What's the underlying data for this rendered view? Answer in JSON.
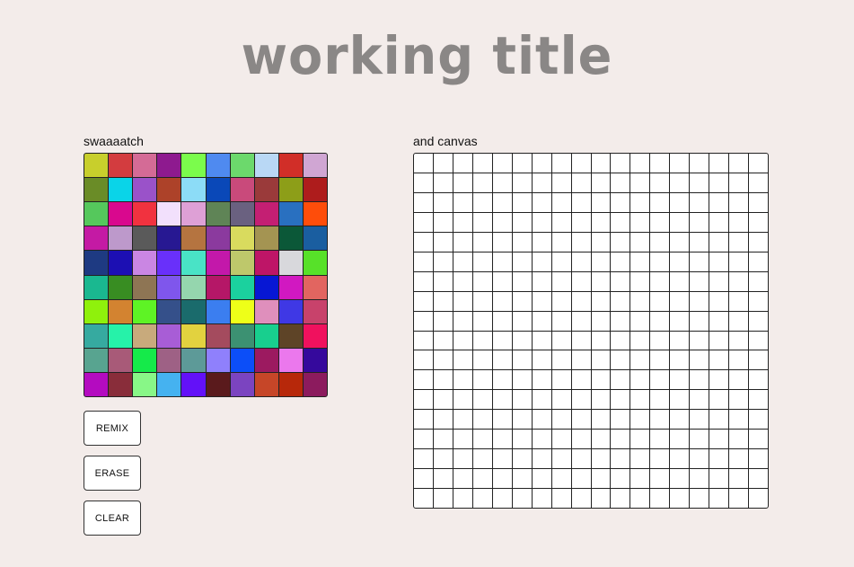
{
  "title": "working title",
  "swatch_section": {
    "label": "swaaaatch",
    "colors": [
      "#c8cf2c",
      "#d33c3f",
      "#d46b96",
      "#8e1a8f",
      "#7bfc4c",
      "#4f8af0",
      "#6cd96c",
      "#b9d8f5",
      "#d12e28",
      "#d0a6d3",
      "#6a8c27",
      "#0ad4e8",
      "#9a52c9",
      "#ad4229",
      "#8cdcf7",
      "#0a48b8",
      "#c94a7b",
      "#9a3a3a",
      "#8d9e18",
      "#ae1c1c",
      "#55c85c",
      "#d9088e",
      "#f1323f",
      "#f2e0fc",
      "#dea0d6",
      "#5f8456",
      "#6a6180",
      "#c41f73",
      "#2970c0",
      "#fe4d0a",
      "#c41aa4",
      "#bd99cb",
      "#5a5a5a",
      "#271892",
      "#b57440",
      "#8b3a9e",
      "#d9db5e",
      "#a49452",
      "#0b5838",
      "#1a5ea0",
      "#1e3a82",
      "#1c0fb3",
      "#ca86e3",
      "#6930fa",
      "#49e3c6",
      "#c318aa",
      "#bec86b",
      "#be1567",
      "#d8d8dc",
      "#57e129",
      "#1ab890",
      "#388d22",
      "#8e7554",
      "#7f56ec",
      "#95d6ae",
      "#b51767",
      "#1bd19e",
      "#0717d4",
      "#d118c1",
      "#e26560",
      "#8ff10c",
      "#d38330",
      "#5ef325",
      "#35508a",
      "#1a6b6c",
      "#3b7ef0",
      "#eeff18",
      "#df8fbc",
      "#3f38e5",
      "#c8426b",
      "#36aaa0",
      "#26f2a9",
      "#c8aa7c",
      "#a85dd6",
      "#e2d23f",
      "#a44b5e",
      "#3c9172",
      "#18cf8e",
      "#5e4427",
      "#f0115e",
      "#58a490",
      "#a85a78",
      "#15ea4a",
      "#9e6185",
      "#5d9a98",
      "#8f80fc",
      "#0c4ef8",
      "#9c1a60",
      "#eb78ed",
      "#35099c",
      "#b40bc0",
      "#892d3a",
      "#88f787",
      "#45b2f0",
      "#6311f8",
      "#5a1a1c",
      "#7b44c0",
      "#c64628",
      "#b7280a",
      "#8c1b5e"
    ]
  },
  "canvas_section": {
    "label": "and canvas",
    "columns": 18,
    "rows": 18,
    "cell_color": "#ffffff"
  },
  "buttons": {
    "remix": "REMIX",
    "erase": "ERASE",
    "clear": "CLEAR"
  }
}
